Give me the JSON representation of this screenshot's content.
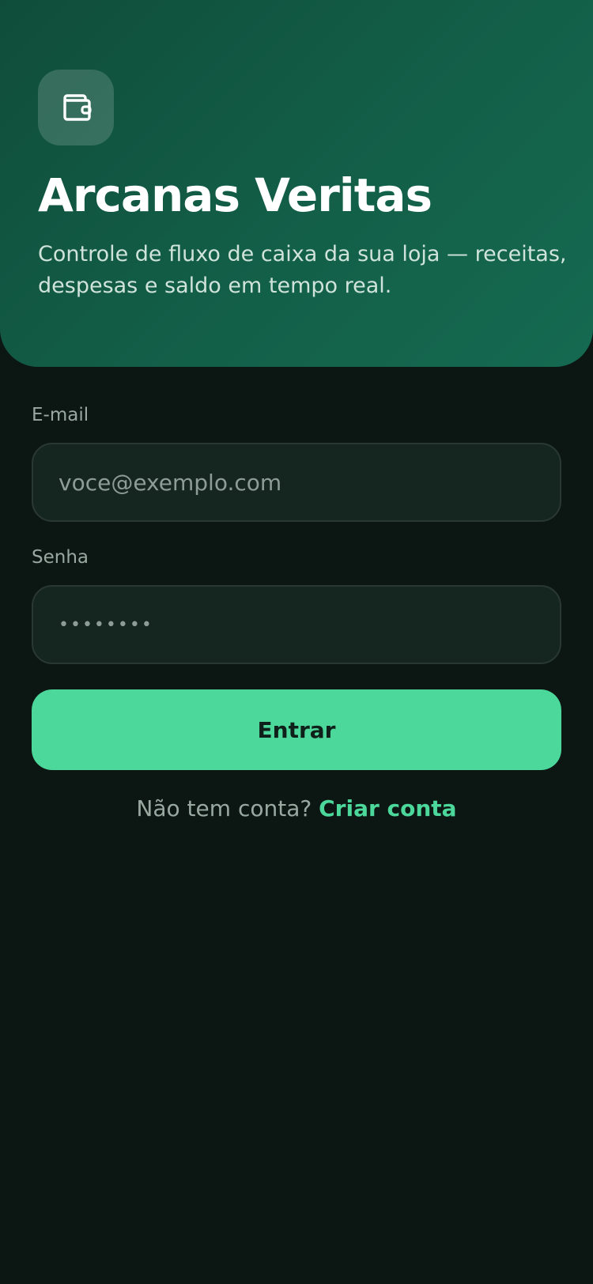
{
  "hero": {
    "logo_icon": "wallet-icon",
    "title": "Arcanas Veritas",
    "subtitle": "Controle de fluxo de caixa da sua loja — receitas, despesas e saldo em tempo real."
  },
  "form": {
    "email": {
      "label": "E-mail",
      "placeholder": "voce@exemplo.com",
      "value": ""
    },
    "password": {
      "label": "Senha",
      "placeholder": "••••••••",
      "value": ""
    },
    "submit_label": "Entrar"
  },
  "signup": {
    "prompt": "Não tem conta?",
    "link_label": "Criar conta"
  },
  "colors": {
    "background": "#0c1714",
    "hero_gradient_start": "#0f4d3a",
    "hero_gradient_end": "#156a50",
    "accent": "#4cd79b",
    "input_background": "#152621",
    "input_border": "#2a3833"
  }
}
